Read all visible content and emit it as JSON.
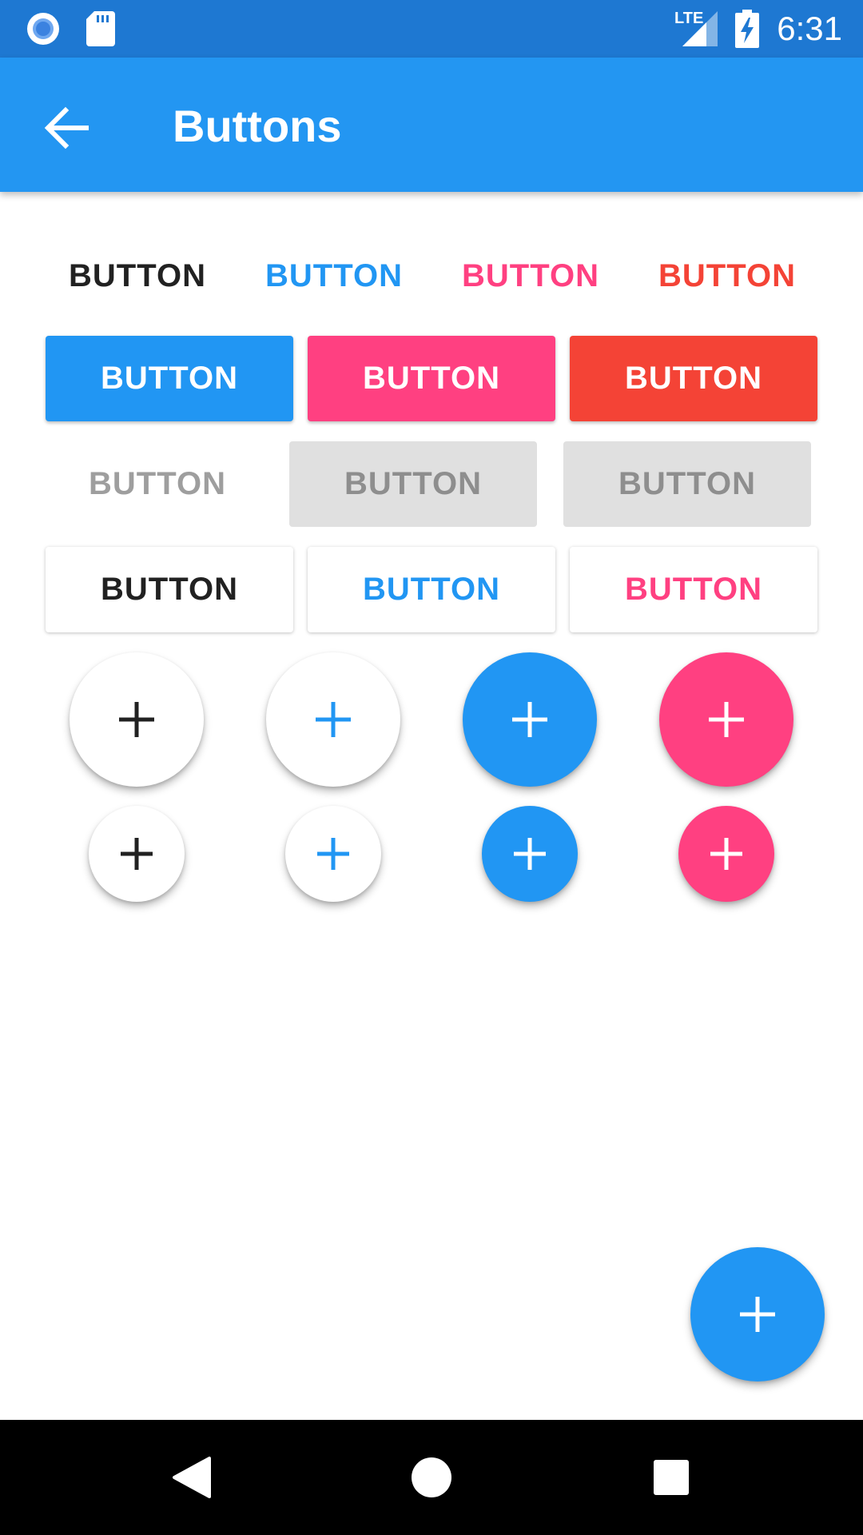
{
  "status_bar": {
    "time": "6:31",
    "network_label": "LTE",
    "icons": [
      "record-icon",
      "sd-card-icon",
      "signal-icon",
      "battery-charging-icon"
    ]
  },
  "app_bar": {
    "title": "Buttons",
    "back_icon": "arrow-back-icon"
  },
  "flat_buttons": [
    {
      "label": "BUTTON",
      "color": "#212121"
    },
    {
      "label": "BUTTON",
      "color": "#2196F3"
    },
    {
      "label": "BUTTON",
      "color": "#FF4081"
    },
    {
      "label": "BUTTON",
      "color": "#F44336"
    }
  ],
  "raised_buttons": [
    {
      "label": "BUTTON",
      "color": "#2196F3"
    },
    {
      "label": "BUTTON",
      "color": "#FF4081"
    },
    {
      "label": "BUTTON",
      "color": "#F44336"
    }
  ],
  "disabled_buttons": [
    {
      "label": "BUTTON",
      "style": "flat"
    },
    {
      "label": "BUTTON",
      "style": "raised"
    },
    {
      "label": "BUTTON",
      "style": "raised"
    }
  ],
  "outlined_buttons": [
    {
      "label": "BUTTON",
      "color": "#212121"
    },
    {
      "label": "BUTTON",
      "color": "#2196F3"
    },
    {
      "label": "BUTTON",
      "color": "#FF4081"
    }
  ],
  "fabs_large": [
    {
      "icon": "plus-icon",
      "background": "#FFFFFF",
      "icon_color": "#212121"
    },
    {
      "icon": "plus-icon",
      "background": "#FFFFFF",
      "icon_color": "#2196F3"
    },
    {
      "icon": "plus-icon",
      "background": "#2196F3",
      "icon_color": "#FFFFFF"
    },
    {
      "icon": "plus-icon",
      "background": "#FF4081",
      "icon_color": "#FFFFFF"
    }
  ],
  "fabs_small": [
    {
      "icon": "plus-icon",
      "background": "#FFFFFF",
      "icon_color": "#212121"
    },
    {
      "icon": "plus-icon",
      "background": "#FFFFFF",
      "icon_color": "#2196F3"
    },
    {
      "icon": "plus-icon",
      "background": "#2196F3",
      "icon_color": "#FFFFFF"
    },
    {
      "icon": "plus-icon",
      "background": "#FF4081",
      "icon_color": "#FFFFFF"
    }
  ],
  "main_fab": {
    "icon": "plus-icon",
    "background": "#2196F3",
    "icon_color": "#FFFFFF"
  },
  "nav_bar": {
    "icons": [
      "back-triangle-icon",
      "home-circle-icon",
      "recents-square-icon"
    ]
  },
  "colors": {
    "primary": "#2196F3",
    "primary_dark": "#1E78D2",
    "accent": "#FF4081",
    "red": "#F44336"
  }
}
